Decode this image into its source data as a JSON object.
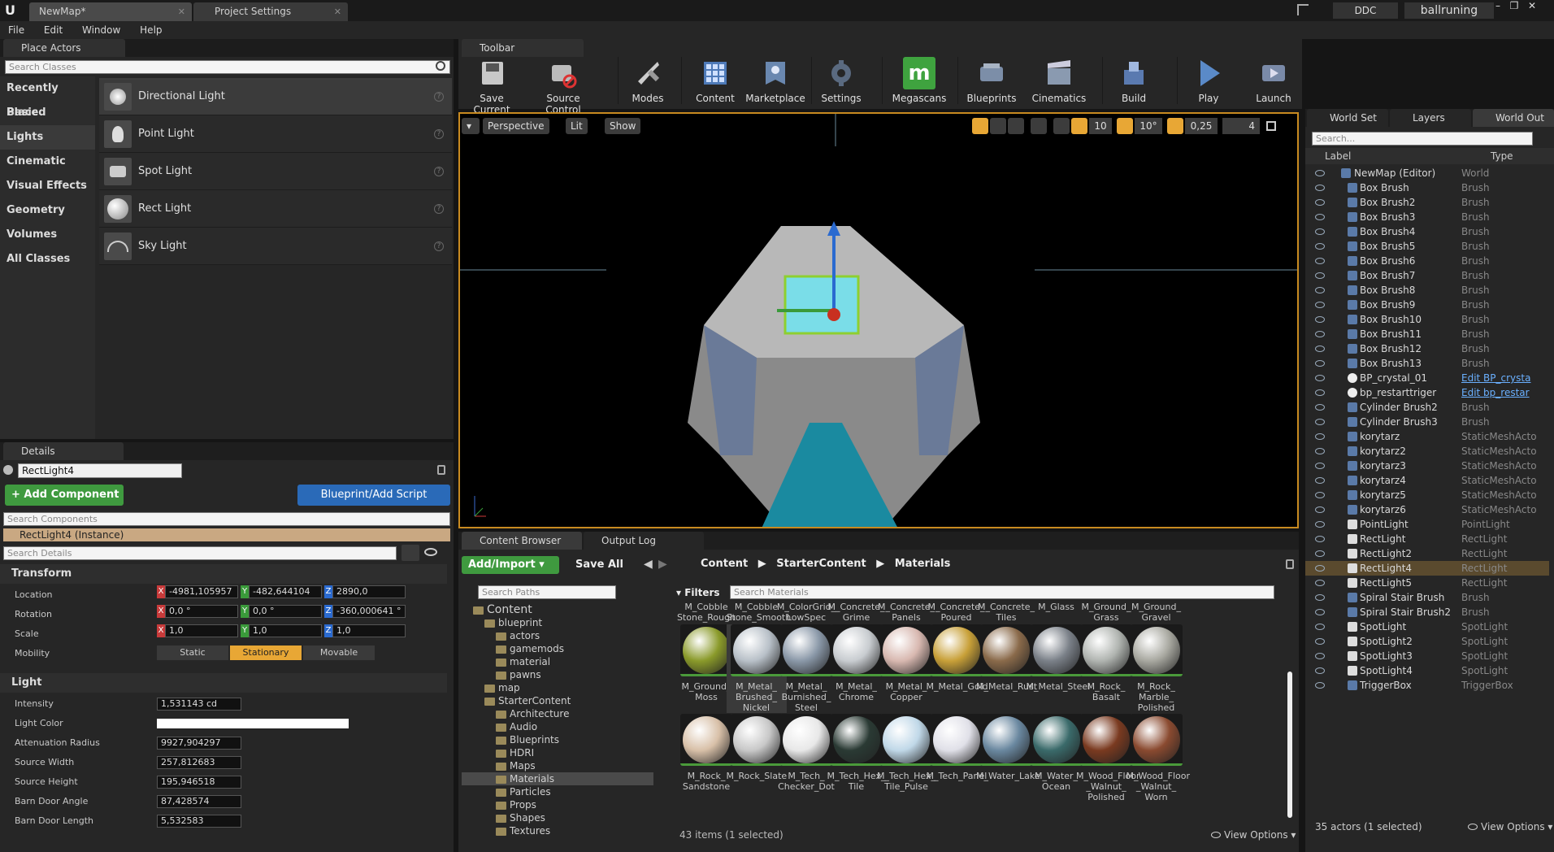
{
  "titlebar": {
    "tabs": [
      "NewMap*",
      "Project Settings"
    ],
    "ddc": "DDC",
    "project": "ballruning"
  },
  "menu": [
    "File",
    "Edit",
    "Window",
    "Help"
  ],
  "place_actors": {
    "title": "Place Actors",
    "search_placeholder": "Search Classes",
    "categories": [
      "Recently Placed",
      "Basic",
      "Lights",
      "Cinematic",
      "Visual Effects",
      "Geometry",
      "Volumes",
      "All Classes"
    ],
    "selected_category": "Lights",
    "actors": [
      "Directional Light",
      "Point Light",
      "Spot Light",
      "Rect Light",
      "Sky Light"
    ]
  },
  "toolbar": {
    "title": "Toolbar",
    "buttons": [
      "Save Current",
      "Source Control",
      "Modes",
      "Content",
      "Marketplace",
      "Settings",
      "Megascans",
      "Blueprints",
      "Cinematics",
      "Build",
      "Play",
      "Launch"
    ]
  },
  "viewport": {
    "perspective": "Perspective",
    "lit": "Lit",
    "show": "Show",
    "grid_snap": "10",
    "rot_snap": "10°",
    "scale_snap": "0,25",
    "cam_speed": "4"
  },
  "details": {
    "title": "Details",
    "actor_name": "RectLight4",
    "add_component": "+ Add Component",
    "blueprint_btn": "Blueprint/Add Script",
    "search_components": "Search Components",
    "instance": "RectLight4 (Instance)",
    "search_details": "Search Details",
    "transform_header": "Transform",
    "location": {
      "label": "Location",
      "x": "-4981,105957",
      "y": "-482,644104",
      "z": "2890,0"
    },
    "rotation": {
      "label": "Rotation",
      "x": "0,0 °",
      "y": "0,0 °",
      "z": "-360,000641 °"
    },
    "scale": {
      "label": "Scale",
      "x": "1,0",
      "y": "1,0",
      "z": "1,0"
    },
    "mobility": {
      "label": "Mobility",
      "options": [
        "Static",
        "Stationary",
        "Movable"
      ],
      "selected": "Stationary"
    },
    "light_header": "Light",
    "light": [
      {
        "label": "Intensity",
        "value": "1,531143 cd"
      },
      {
        "label": "Light Color",
        "value": ""
      },
      {
        "label": "Attenuation Radius",
        "value": "9927,904297"
      },
      {
        "label": "Source Width",
        "value": "257,812683"
      },
      {
        "label": "Source Height",
        "value": "195,946518"
      },
      {
        "label": "Barn Door Angle",
        "value": "87,428574"
      },
      {
        "label": "Barn Door Length",
        "value": "5,532583"
      }
    ]
  },
  "content_browser": {
    "title": "Content Browser",
    "output_log": "Output Log",
    "add_import": "Add/Import",
    "save_all": "Save All",
    "breadcrumb": [
      "Content",
      "StarterContent",
      "Materials"
    ],
    "search_paths": "Search Paths",
    "filters": "Filters",
    "search_materials": "Search Materials",
    "tree": [
      {
        "name": "Content",
        "level": 0
      },
      {
        "name": "blueprint",
        "level": 1
      },
      {
        "name": "actors",
        "level": 2
      },
      {
        "name": "gamemods",
        "level": 2
      },
      {
        "name": "material",
        "level": 2
      },
      {
        "name": "pawns",
        "level": 2
      },
      {
        "name": "map",
        "level": 1
      },
      {
        "name": "StarterContent",
        "level": 1
      },
      {
        "name": "Architecture",
        "level": 2
      },
      {
        "name": "Audio",
        "level": 2
      },
      {
        "name": "Blueprints",
        "level": 2
      },
      {
        "name": "HDRI",
        "level": 2
      },
      {
        "name": "Maps",
        "level": 2
      },
      {
        "name": "Materials",
        "level": 2
      },
      {
        "name": "Particles",
        "level": 2
      },
      {
        "name": "Props",
        "level": 2
      },
      {
        "name": "Shapes",
        "level": 2
      },
      {
        "name": "Textures",
        "level": 2
      }
    ],
    "top_row": [
      "M_Cobble Stone_Rough",
      "M_Cobble Stone_Smooth",
      "M_ColorGrid_ LowSpec",
      "M_Concrete_ Grime",
      "M_Concrete_ Panels",
      "M_Concrete_ Poured",
      "M_Concrete_ Tiles",
      "M_Glass",
      "M_Ground_ Grass",
      "M_Ground_ Gravel"
    ],
    "row1": [
      "M_Ground_ Moss",
      "M_Metal_ Brushed_ Nickel",
      "M_Metal_ Burnished_ Steel",
      "M_Metal_ Chrome",
      "M_Metal_ Copper",
      "M_Metal_Gold",
      "M_Metal_Rust",
      "M_Metal_Steel",
      "M_Rock_ Basalt",
      "M_Rock_ Marble_ Polished"
    ],
    "row2": [
      "M_Rock_ Sandstone",
      "M_Rock_Slate",
      "M_Tech_ Checker_Dot",
      "M_Tech_Hex_ Tile",
      "M_Tech_Hex_ Tile_Pulse",
      "M_Tech_Panel",
      "M_Water_Lake",
      "M_Water_ Ocean",
      "M_Wood_Floor _Walnut_ Polished",
      "M_Wood_Floor _Walnut_ Worn"
    ],
    "status": "43 items (1 selected)",
    "view_options": "View Options"
  },
  "world_outliner": {
    "tabs": [
      "World Set",
      "Layers",
      "World Out"
    ],
    "search_placeholder": "Search...",
    "col_label": "Label",
    "col_type": "Type",
    "items": [
      {
        "name": "NewMap (Editor)",
        "type": "World"
      },
      {
        "name": "Box Brush",
        "type": "Brush"
      },
      {
        "name": "Box Brush2",
        "type": "Brush"
      },
      {
        "name": "Box Brush3",
        "type": "Brush"
      },
      {
        "name": "Box Brush4",
        "type": "Brush"
      },
      {
        "name": "Box Brush5",
        "type": "Brush"
      },
      {
        "name": "Box Brush6",
        "type": "Brush"
      },
      {
        "name": "Box Brush7",
        "type": "Brush"
      },
      {
        "name": "Box Brush8",
        "type": "Brush"
      },
      {
        "name": "Box Brush9",
        "type": "Brush"
      },
      {
        "name": "Box Brush10",
        "type": "Brush"
      },
      {
        "name": "Box Brush11",
        "type": "Brush"
      },
      {
        "name": "Box Brush12",
        "type": "Brush"
      },
      {
        "name": "Box Brush13",
        "type": "Brush"
      },
      {
        "name": "BP_crystal_01",
        "type": "Edit BP_crysta"
      },
      {
        "name": "bp_restarttriger",
        "type": "Edit bp_restar"
      },
      {
        "name": "Cylinder Brush2",
        "type": "Brush"
      },
      {
        "name": "Cylinder Brush3",
        "type": "Brush"
      },
      {
        "name": "korytarz",
        "type": "StaticMeshActo"
      },
      {
        "name": "korytarz2",
        "type": "StaticMeshActo"
      },
      {
        "name": "korytarz3",
        "type": "StaticMeshActo"
      },
      {
        "name": "korytarz4",
        "type": "StaticMeshActo"
      },
      {
        "name": "korytarz5",
        "type": "StaticMeshActo"
      },
      {
        "name": "korytarz6",
        "type": "StaticMeshActo"
      },
      {
        "name": "PointLight",
        "type": "PointLight"
      },
      {
        "name": "RectLight",
        "type": "RectLight"
      },
      {
        "name": "RectLight2",
        "type": "RectLight"
      },
      {
        "name": "RectLight4",
        "type": "RectLight"
      },
      {
        "name": "RectLight5",
        "type": "RectLight"
      },
      {
        "name": "Spiral Stair Brush",
        "type": "Brush"
      },
      {
        "name": "Spiral Stair Brush2",
        "type": "Brush"
      },
      {
        "name": "SpotLight",
        "type": "SpotLight"
      },
      {
        "name": "SpotLight2",
        "type": "SpotLight"
      },
      {
        "name": "SpotLight3",
        "type": "SpotLight"
      },
      {
        "name": "SpotLight4",
        "type": "SpotLight"
      },
      {
        "name": "TriggerBox",
        "type": "TriggerBox"
      }
    ],
    "selected": "RectLight4",
    "status": "35 actors (1 selected)",
    "view_options": "View Options"
  },
  "colors": {
    "accent": "#e8a735",
    "selection": "#5a4a2e",
    "green": "#3f9a3f",
    "blue": "#2a7ad0"
  }
}
